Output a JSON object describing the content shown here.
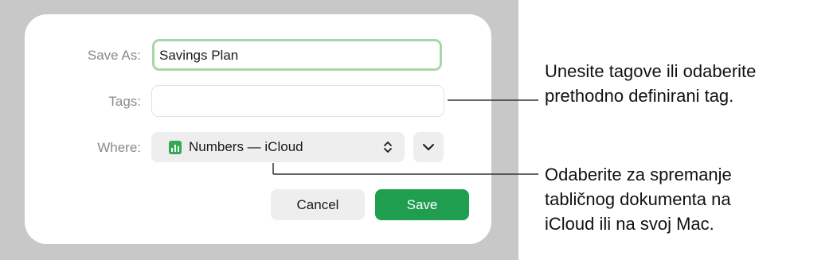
{
  "dialog": {
    "save_as_label": "Save As:",
    "save_as_value": "Savings Plan",
    "tags_label": "Tags:",
    "tags_value": "",
    "where_label": "Where:",
    "where_value": "Numbers — iCloud",
    "cancel_label": "Cancel",
    "save_label": "Save",
    "icons": {
      "location": "numbers-app-icon",
      "popup": "up-down-chevron-icon",
      "expand": "chevron-down-icon"
    }
  },
  "callouts": {
    "tags_line1": "Unesite tagove ili odaberite",
    "tags_line2": "prethodno definirani tag.",
    "where_line1": "Odaberite za spremanje",
    "where_line2": "tabličnog dokumenta na",
    "where_line3": "iCloud ili na svoj Mac."
  },
  "colors": {
    "save_button": "#1f9e50",
    "focus_ring": "#a9d6a8",
    "numbers_icon": "#34a853",
    "backdrop": "#c8c8c8"
  }
}
